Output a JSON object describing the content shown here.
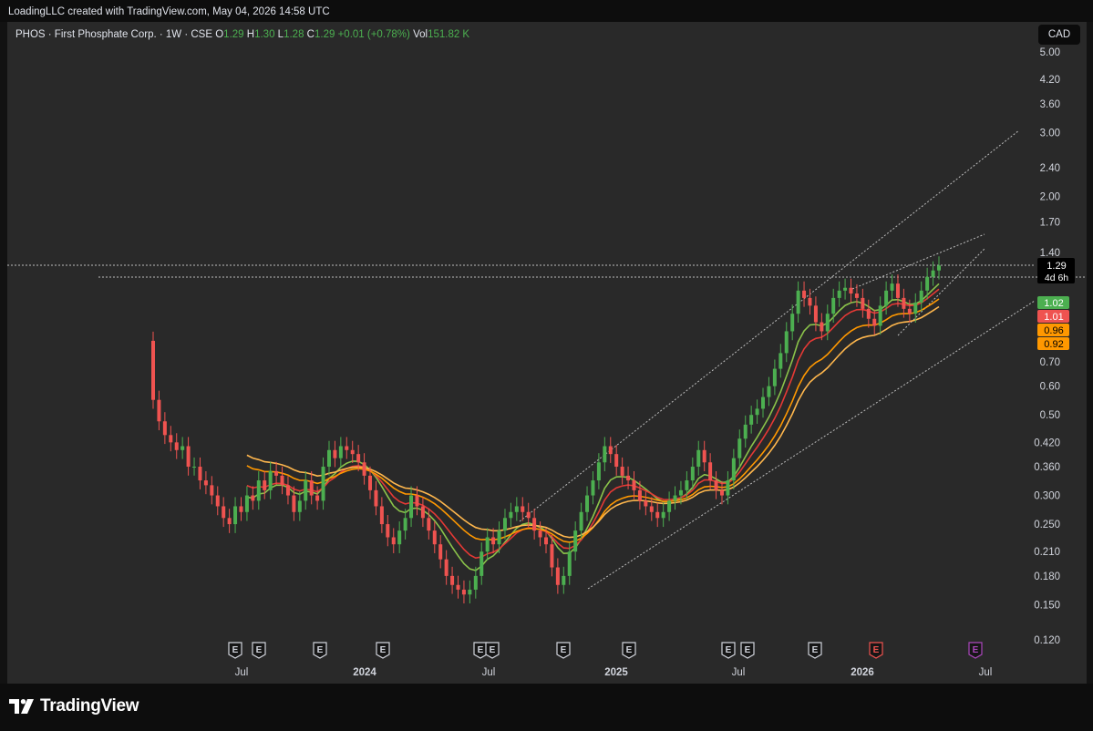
{
  "header": {
    "attribution": "LoadingLLC created with TradingView.com, May 04, 2026 14:58 UTC"
  },
  "legend": {
    "symbol": "PHOS · First Phosphate Corp. · 1W · CSE",
    "open_label": "O",
    "open": "1.29",
    "high_label": "H",
    "high": "1.30",
    "low_label": "L",
    "low": "1.28",
    "close_label": "C",
    "close": "1.29",
    "change": "+0.01 (+0.78%)",
    "volume_label": "Vol",
    "volume": "151.82 K"
  },
  "currency": "CAD",
  "colors": {
    "up": "#4caf50",
    "down": "#ef5350",
    "ema_fast": "#8bc34a",
    "ema_slow": "#e53935",
    "ema_orange": "#ff9800",
    "ema_light": "#ffb74d",
    "earnings_past": "#d1d4dc",
    "earnings_red": "#ef5350",
    "earnings_future": "#ab47bc"
  },
  "footer": {
    "brand": "TradingView"
  },
  "chart_data": {
    "type": "candlestick",
    "scale": "log",
    "ylim": [
      0.1,
      5.5
    ],
    "y_ticks": [
      "5.00",
      "4.20",
      "3.60",
      "3.00",
      "2.40",
      "2.00",
      "1.70",
      "1.40",
      "0.70",
      "0.60",
      "0.50",
      "0.420",
      "0.360",
      "0.300",
      "0.250",
      "0.210",
      "0.180",
      "0.150",
      "0.120"
    ],
    "x_ticks": [
      "Jul",
      "2024",
      "Jul",
      "2025",
      "Jul",
      "2026",
      "Jul"
    ],
    "price_labels": [
      {
        "text": "1.29",
        "sub": "4d 6h",
        "kind": "last"
      },
      {
        "text": "1.02",
        "kind": "green"
      },
      {
        "text": "1.01",
        "kind": "red"
      },
      {
        "text": "0.96",
        "kind": "orange"
      },
      {
        "text": "0.92",
        "kind": "orange"
      }
    ],
    "earnings_markers": [
      {
        "label": "E",
        "kind": "past"
      },
      {
        "label": "E",
        "kind": "past"
      },
      {
        "label": "E",
        "kind": "past"
      },
      {
        "label": "E",
        "kind": "past"
      },
      {
        "label": "E",
        "kind": "past"
      },
      {
        "label": "E",
        "kind": "past"
      },
      {
        "label": "E",
        "kind": "past"
      },
      {
        "label": "E",
        "kind": "past"
      },
      {
        "label": "E",
        "kind": "past"
      },
      {
        "label": "E",
        "kind": "past"
      },
      {
        "label": "E",
        "kind": "past"
      },
      {
        "label": "E",
        "kind": "red"
      },
      {
        "label": "E",
        "kind": "future"
      }
    ],
    "candles_close": [
      0.55,
      0.48,
      0.44,
      0.42,
      0.4,
      0.41,
      0.36,
      0.36,
      0.33,
      0.32,
      0.3,
      0.28,
      0.26,
      0.25,
      0.28,
      0.27,
      0.3,
      0.29,
      0.33,
      0.31,
      0.35,
      0.34,
      0.32,
      0.3,
      0.27,
      0.29,
      0.33,
      0.3,
      0.29,
      0.36,
      0.4,
      0.38,
      0.41,
      0.4,
      0.39,
      0.37,
      0.34,
      0.31,
      0.28,
      0.25,
      0.23,
      0.22,
      0.24,
      0.26,
      0.3,
      0.28,
      0.26,
      0.24,
      0.22,
      0.2,
      0.18,
      0.17,
      0.165,
      0.16,
      0.165,
      0.18,
      0.21,
      0.23,
      0.22,
      0.24,
      0.26,
      0.27,
      0.28,
      0.27,
      0.26,
      0.24,
      0.23,
      0.22,
      0.19,
      0.17,
      0.18,
      0.21,
      0.24,
      0.27,
      0.3,
      0.33,
      0.37,
      0.41,
      0.39,
      0.36,
      0.34,
      0.33,
      0.31,
      0.29,
      0.28,
      0.27,
      0.26,
      0.27,
      0.29,
      0.3,
      0.31,
      0.33,
      0.36,
      0.4,
      0.37,
      0.33,
      0.31,
      0.3,
      0.33,
      0.38,
      0.43,
      0.47,
      0.5,
      0.52,
      0.56,
      0.6,
      0.67,
      0.74,
      0.85,
      0.95,
      1.1,
      1.05,
      1.0,
      0.9,
      0.85,
      0.95,
      1.05,
      1.1,
      1.12,
      1.08,
      1.05,
      0.98,
      0.92,
      0.88,
      1.0,
      1.1,
      1.15,
      1.05,
      0.98,
      0.95,
      1.02,
      1.1,
      1.2,
      1.25,
      1.29
    ]
  }
}
